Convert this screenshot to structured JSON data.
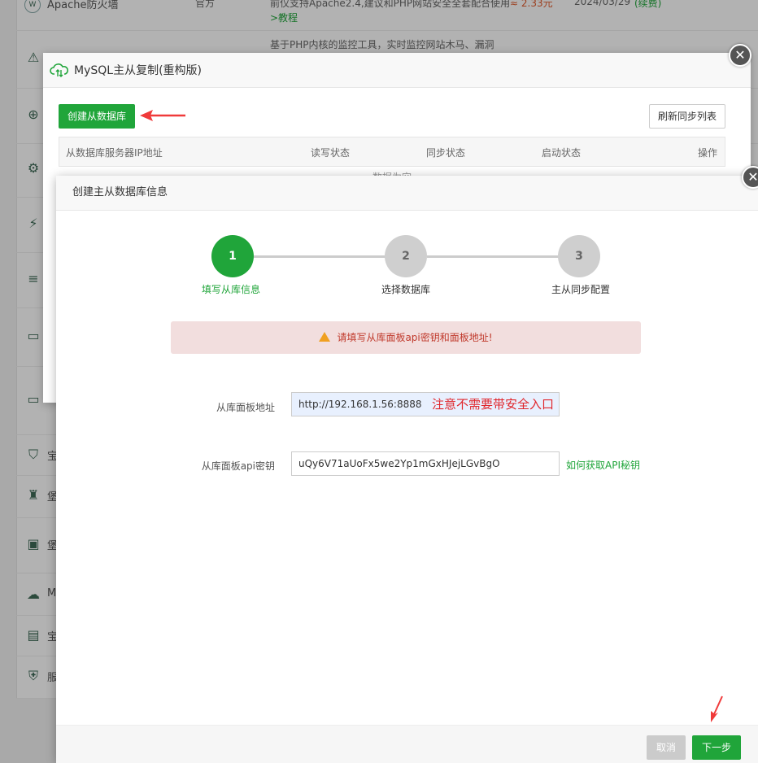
{
  "background_list": {
    "row_top": {
      "name": "Apache防火墙",
      "source": "官方",
      "desc": "前仅支持Apache2.4,建议和PHP网站安全全套配合使用",
      "desc_link": ">教程",
      "price": "≈ 2.33元",
      "date": "2024/03/29",
      "renew": "(续费)"
    },
    "row_second_desc": "基于PHP内核的监控工具，实时监控网站木马、漏洞",
    "partial_labels": [
      "宝",
      "堡",
      "堡",
      "M",
      "宝",
      "服"
    ]
  },
  "mysql_modal": {
    "title": "MySQL主从复制(重构版)",
    "create_button": "创建从数据库",
    "refresh_button": "刷新同步列表",
    "columns": [
      "从数据库服务器IP地址",
      "读写状态",
      "同步状态",
      "启动状态",
      "操作"
    ],
    "empty_text": "数据为空"
  },
  "create_modal": {
    "title": "创建主从数据库信息",
    "steps": [
      {
        "number": "1",
        "label": "填写从库信息",
        "active": true
      },
      {
        "number": "2",
        "label": "选择数据库",
        "active": false
      },
      {
        "number": "3",
        "label": "主从同步配置",
        "active": false
      }
    ],
    "alert": "请填写从库面板api密钥和面板地址!",
    "panel_address_label": "从库面板地址",
    "panel_address_value": "http://192.168.1.56:8888",
    "panel_address_note": "注意不需要带安全入口",
    "api_key_label": "从库面板api密钥",
    "api_key_value": "uQy6V71aUoFx5we2Yp1mGxHJejLGvBgO",
    "api_help_link": "如何获取API秘钥",
    "cancel_button": "取消",
    "next_button": "下一步"
  },
  "colors": {
    "brand_green": "#20a53a",
    "alert_bg": "#f2dede",
    "alert_text": "#c0392b",
    "annotation_red": "#e0262c"
  }
}
